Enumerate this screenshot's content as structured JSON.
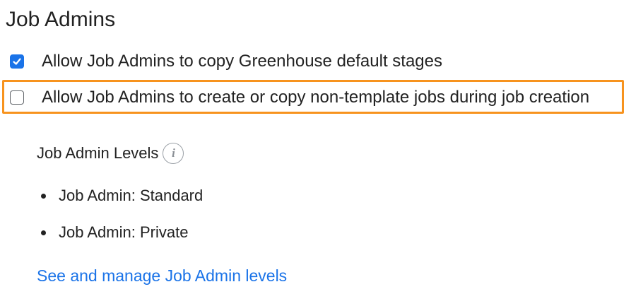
{
  "section": {
    "title": "Job Admins"
  },
  "options": [
    {
      "label": "Allow Job Admins to copy Greenhouse default stages",
      "checked": true
    },
    {
      "label": "Allow Job Admins to create or copy non-template jobs during job creation",
      "checked": false
    }
  ],
  "levels": {
    "heading": "Job Admin Levels",
    "info_icon": "info-icon",
    "items": [
      "Job Admin: Standard",
      "Job Admin: Private"
    ]
  },
  "link": {
    "label": "See and manage Job Admin levels"
  },
  "colors": {
    "accent": "#1a73e8",
    "highlight": "#f7931e",
    "text": "#222222"
  }
}
